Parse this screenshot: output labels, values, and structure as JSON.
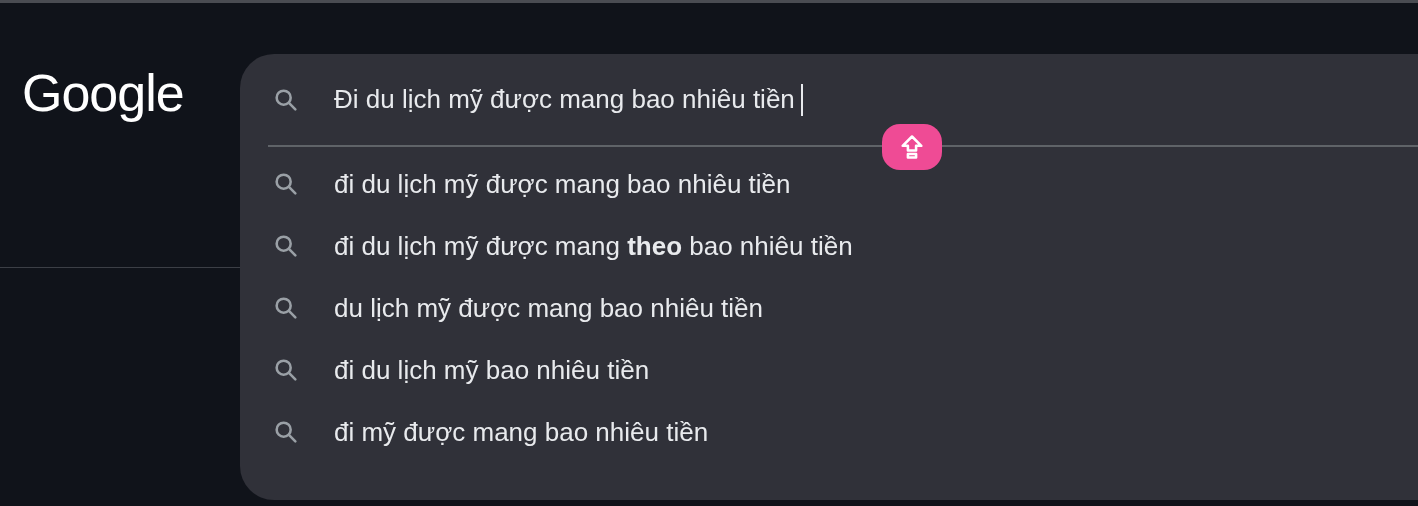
{
  "logo": {
    "text": "Google"
  },
  "search": {
    "value": "Đi du lịch mỹ được mang bao nhiêu tiền"
  },
  "suggestions": [
    {
      "text": "đi du lịch mỹ được mang bao nhiêu tiền"
    },
    {
      "text": "đi du lịch mỹ được mang **theo** bao nhiêu tiền"
    },
    {
      "text": "du lịch mỹ được mang bao nhiêu tiền"
    },
    {
      "text": "đi du lịch mỹ bao nhiêu tiền"
    },
    {
      "text": "đi mỹ được mang bao nhiêu tiền"
    }
  ]
}
